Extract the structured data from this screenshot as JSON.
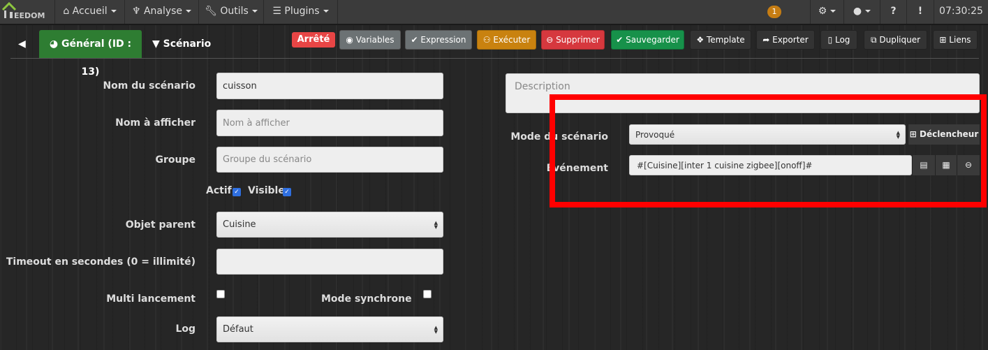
{
  "nav": {
    "logo": "EEDOM",
    "items": [
      {
        "label": "Accueil",
        "icon": "home-icon"
      },
      {
        "label": "Analyse",
        "icon": "stethoscope-icon"
      },
      {
        "label": "Outils",
        "icon": "wrench-icon"
      },
      {
        "label": "Plugins",
        "icon": "list-icon"
      }
    ],
    "notification_count": "1",
    "time": "07:30:25"
  },
  "tabs": {
    "general": "Général (ID : 13)",
    "scenario": "Scénario"
  },
  "toolbar": {
    "status": "Arrêté",
    "variables": "Variables",
    "expression": "Expression",
    "executer": "Exécuter",
    "supprimer": "Supprimer",
    "sauvegarder": "Sauvegarder",
    "template": "Template",
    "exporter": "Exporter",
    "log": "Log",
    "dupliquer": "Dupliquer",
    "liens": "Liens"
  },
  "colors": {
    "green": "#2e7d32",
    "orange": "#c9820f",
    "red": "#d6383e",
    "save": "#17914a",
    "highlight": "#ff0000"
  },
  "form": {
    "nom_label": "Nom du scénario",
    "nom_value": "cuisson",
    "afficher_label": "Nom à afficher",
    "afficher_placeholder": "Nom à afficher",
    "groupe_label": "Groupe",
    "groupe_placeholder": "Groupe du scénario",
    "actif_label": "Actif",
    "actif": true,
    "visible_label": "Visible",
    "visible": true,
    "parent_label": "Objet parent",
    "parent_value": "Cuisine",
    "timeout_label": "Timeout en secondes (0 = illimité)",
    "timeout_value": "",
    "multi_label": "Multi lancement",
    "multi": false,
    "sync_label": "Mode synchrone",
    "sync": false,
    "log_label": "Log",
    "log_value": "Défaut",
    "description_placeholder": "Description",
    "mode_label": "Mode du scénario",
    "mode_value": "Provoqué",
    "declencheur": "Déclencheur",
    "event_label": "Événement",
    "event_value": "#[Cuisine][inter 1 cuisine zigbee][onoff]#"
  }
}
